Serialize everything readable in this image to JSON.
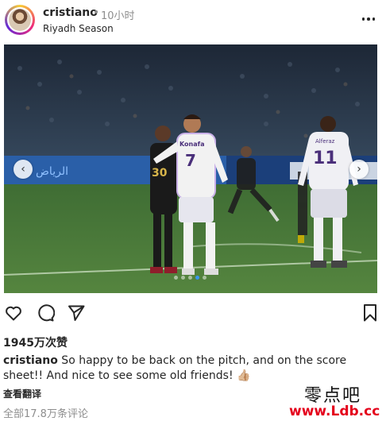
{
  "post": {
    "username": "cristiano",
    "separator": "•",
    "time": "10小时",
    "location": "Riyadh Season"
  },
  "media": {
    "slide_count": 5,
    "active_slide": 4,
    "banner_text_left": "ﺍﻟﺮﻳﺎﺽ",
    "jersey_left_number": "7",
    "jersey_left_brand": "Konafa",
    "jersey_right_number": "11",
    "jersey_right_name": "Alferaz",
    "jersey_dark_number": "30",
    "prev_icon": "chevron-left-icon",
    "next_icon": "chevron-right-icon"
  },
  "actions": {
    "like_icon": "heart-icon",
    "comment_icon": "comment-icon",
    "share_icon": "send-icon",
    "save_icon": "bookmark-icon"
  },
  "likes": "1945万次赞",
  "caption": {
    "username": "cristiano",
    "text": " So happy to be back on the pitch, and on the score sheet!! And nice to see some old friends! 👍🏼"
  },
  "translate_label": "查看翻译",
  "comments_label": "全部17.8万条评论",
  "watermark": {
    "line1": "零点吧",
    "line2": "www.Ldb.cc"
  }
}
